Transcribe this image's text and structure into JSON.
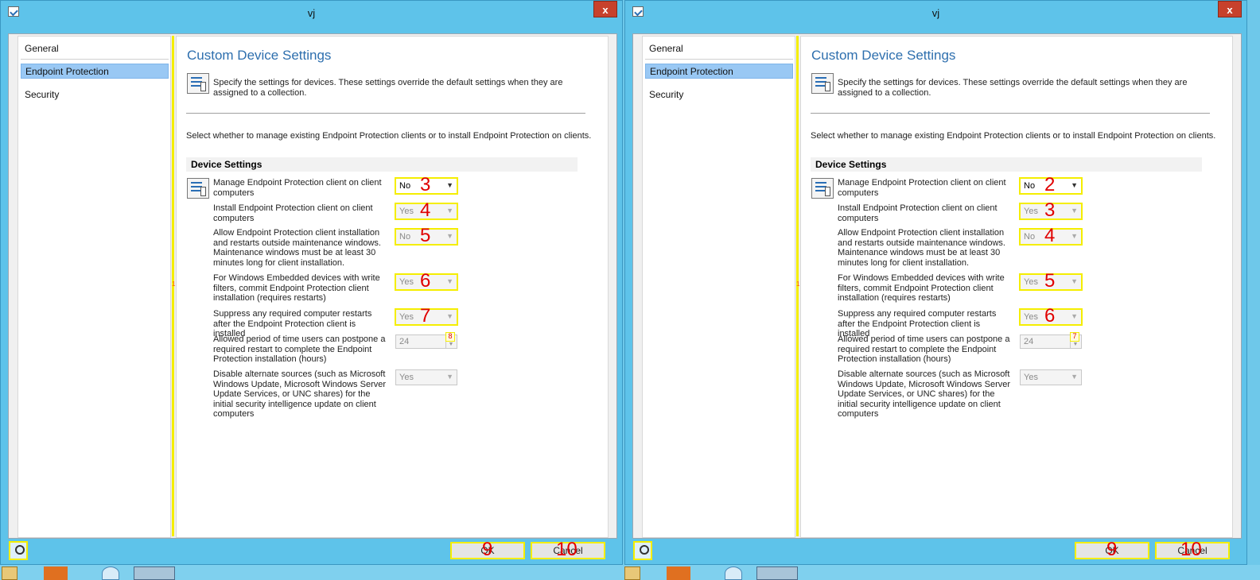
{
  "colors": {
    "accent": "#2e6fae",
    "highlight": "#f5ee00",
    "badge": "#e00000",
    "titlebar": "#5ec3ea",
    "close": "#c7412c",
    "selected": "#99c8f4"
  },
  "windows": [
    {
      "title": "vj",
      "close_label": "x",
      "splitter_mark": "1",
      "nav": [
        "General",
        "Endpoint Protection",
        "Security"
      ],
      "heading": "Custom Device Settings",
      "description": "Specify the settings for devices. These settings override the default settings when they are assigned to a collection.",
      "select_text": "Select whether to manage existing Endpoint Protection clients or to install Endpoint Protection on clients.",
      "section": "Device Settings",
      "settings": [
        {
          "label": "Manage Endpoint Protection client on client computers",
          "value": "No",
          "badge": "3"
        },
        {
          "label": "Install Endpoint Protection client on client computers",
          "value": "Yes",
          "badge": "4"
        },
        {
          "label": "Allow Endpoint Protection client installation and restarts outside maintenance windows. Maintenance windows must be at least 30 minutes long for client installation.",
          "value": "No",
          "badge": "5"
        },
        {
          "label": "For Windows Embedded devices with write filters, commit Endpoint Protection client installation (requires restarts)",
          "value": "Yes",
          "badge": "6"
        },
        {
          "label": "Suppress any required computer restarts after the Endpoint Protection client is installed",
          "value": "Yes",
          "badge": "7"
        },
        {
          "label": "Allowed period of time users can postpone a required restart to complete the Endpoint Protection installation (hours)",
          "value": "24",
          "badge": "8"
        },
        {
          "label": "Disable alternate sources (such as Microsoft Windows Update, Microsoft Windows Server Update Services, or UNC shares) for the initial security intelligence update on client computers",
          "value": "Yes"
        }
      ],
      "ok": {
        "label": "OK",
        "badge": "9"
      },
      "cancel": {
        "label": "Cancel",
        "badge": "10"
      }
    },
    {
      "title": "vj",
      "close_label": "x",
      "splitter_mark": "1",
      "nav": [
        "General",
        "Endpoint Protection",
        "Security"
      ],
      "heading": "Custom Device Settings",
      "description": "Specify the settings for devices. These settings override the default settings when they are assigned to a collection.",
      "select_text": "Select whether to manage existing Endpoint Protection clients or to install Endpoint Protection on clients.",
      "section": "Device Settings",
      "settings": [
        {
          "label": "Manage Endpoint Protection client on client computers",
          "value": "No",
          "badge": "2"
        },
        {
          "label": "Install Endpoint Protection client on client computers",
          "value": "Yes",
          "badge": "3"
        },
        {
          "label": "Allow Endpoint Protection client installation and restarts outside maintenance windows. Maintenance windows must be at least 30 minutes long for client installation.",
          "value": "No",
          "badge": "4"
        },
        {
          "label": "For Windows Embedded devices with write filters, commit Endpoint Protection client installation (requires restarts)",
          "value": "Yes",
          "badge": "5"
        },
        {
          "label": "Suppress any required computer restarts after the Endpoint Protection client is installed",
          "value": "Yes",
          "badge": "6"
        },
        {
          "label": "Allowed period of time users can postpone a required restart to complete the Endpoint Protection installation (hours)",
          "value": "24",
          "badge": "7"
        },
        {
          "label": "Disable alternate sources (such as Microsoft Windows Update, Microsoft Windows Server Update Services, or UNC shares) for the initial security intelligence update on client computers",
          "value": "Yes"
        }
      ],
      "ok": {
        "label": "OK",
        "badge": "9"
      },
      "cancel": {
        "label": "Cancel",
        "badge": "10"
      }
    }
  ]
}
